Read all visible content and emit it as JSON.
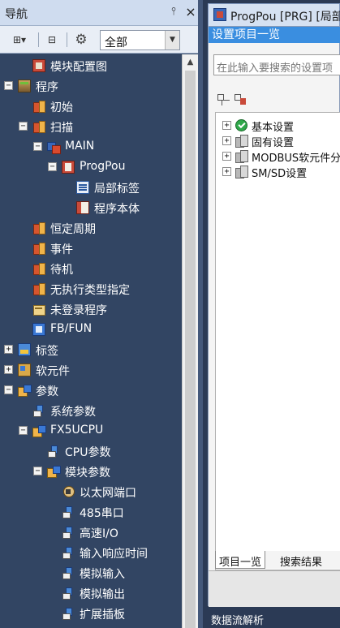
{
  "nav": {
    "title": "导航",
    "pin_glyph": "ᵖ",
    "close_glyph": "×",
    "filter": {
      "selected": "全部"
    },
    "toolbar": {
      "tree_icon": "tree-view-icon",
      "collapse_icon": "collapse-all-icon",
      "gear_icon": "gear-icon",
      "tree_glyph": "⊞▾",
      "collapse_glyph": "⊟",
      "gear_glyph": "⚙"
    },
    "tree": [
      {
        "label": "模块配置图",
        "icon": "module-config-icon",
        "expander": ""
      },
      {
        "label": "程序",
        "icon": "program-icon",
        "expander": "−"
      },
      {
        "label": "初始",
        "icon": "task-icon",
        "expander": ""
      },
      {
        "label": "扫描",
        "icon": "task-icon",
        "expander": "−"
      },
      {
        "label": "MAIN",
        "icon": "main-program-icon",
        "expander": "−"
      },
      {
        "label": "ProgPou",
        "icon": "pou-icon",
        "expander": "−"
      },
      {
        "label": "局部标签",
        "icon": "local-label-icon",
        "expander": ""
      },
      {
        "label": "程序本体",
        "icon": "program-body-icon",
        "expander": ""
      },
      {
        "label": "恒定周期",
        "icon": "task-icon",
        "expander": ""
      },
      {
        "label": "事件",
        "icon": "task-icon",
        "expander": ""
      },
      {
        "label": "待机",
        "icon": "task-icon",
        "expander": ""
      },
      {
        "label": "无执行类型指定",
        "icon": "task-icon",
        "expander": ""
      },
      {
        "label": "未登录程序",
        "icon": "unregistered-program-icon",
        "expander": ""
      },
      {
        "label": "FB/FUN",
        "icon": "fb-fun-icon",
        "expander": ""
      },
      {
        "label": "标签",
        "icon": "label-icon",
        "expander": "+"
      },
      {
        "label": "软元件",
        "icon": "device-icon",
        "expander": "+"
      },
      {
        "label": "参数",
        "icon": "parameter-icon",
        "expander": "−"
      },
      {
        "label": "系统参数",
        "icon": "system-parameter-icon",
        "expander": ""
      },
      {
        "label": "FX5UCPU",
        "icon": "parameter-icon",
        "expander": "−"
      },
      {
        "label": "CPU参数",
        "icon": "system-parameter-icon",
        "expander": ""
      },
      {
        "label": "模块参数",
        "icon": "parameter-icon",
        "expander": "−"
      },
      {
        "label": "以太网端口",
        "icon": "ethernet-port-icon",
        "expander": ""
      },
      {
        "label": "485串口",
        "icon": "system-parameter-icon",
        "expander": ""
      },
      {
        "label": "高速I/O",
        "icon": "system-parameter-icon",
        "expander": ""
      },
      {
        "label": "输入响应时间",
        "icon": "system-parameter-icon",
        "expander": ""
      },
      {
        "label": "模拟输入",
        "icon": "system-parameter-icon",
        "expander": ""
      },
      {
        "label": "模拟输出",
        "icon": "system-parameter-icon",
        "expander": ""
      },
      {
        "label": "扩展插板",
        "icon": "system-parameter-icon",
        "expander": ""
      }
    ]
  },
  "doc": {
    "tab_title": "ProgPou [PRG] [局部",
    "settings": {
      "title": "设置项目一览",
      "search_placeholder": "在此输入要搜索的设置项",
      "items": [
        {
          "label": "基本设置",
          "icon": "check-icon",
          "expander": "+"
        },
        {
          "label": "固有设置",
          "icon": "settings-group-icon",
          "expander": "+"
        },
        {
          "label": "MODBUS软元件分",
          "icon": "settings-group-icon",
          "expander": "+"
        },
        {
          "label": "SM/SD设置",
          "icon": "settings-group-icon",
          "expander": "+"
        }
      ],
      "tabs": {
        "items": "项目一览",
        "results": "搜索结果"
      }
    },
    "bottom_panel_title": "数据流解析"
  }
}
